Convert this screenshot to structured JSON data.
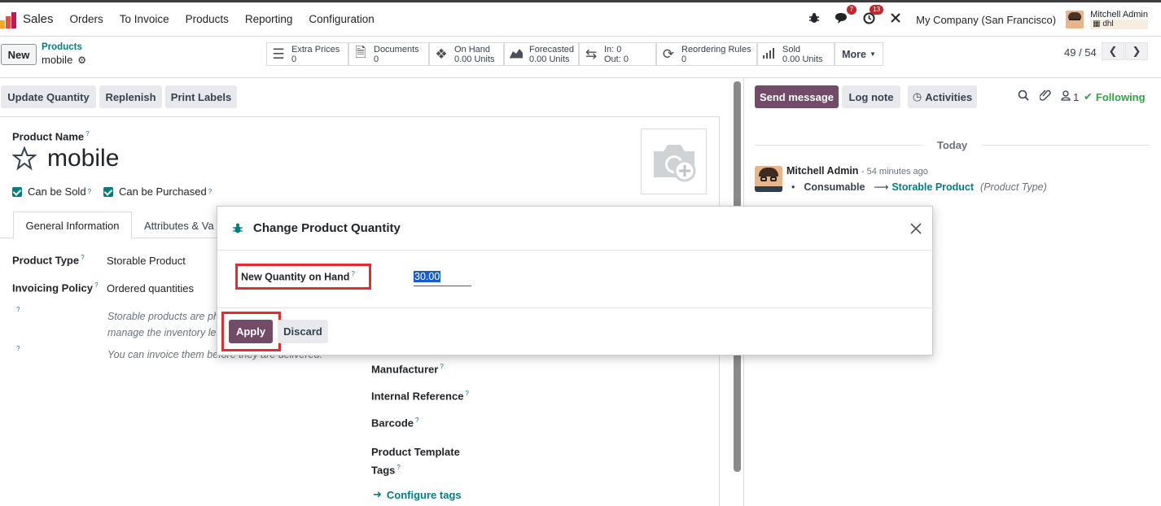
{
  "navbar": {
    "app": "Sales",
    "menu": [
      "Orders",
      "To Invoice",
      "Products",
      "Reporting",
      "Configuration"
    ],
    "messages_badge": "7",
    "activities_badge": "13",
    "company": "My Company (San Francisco)",
    "user_name": "Mitchell Admin",
    "user_db": "dhl"
  },
  "control_panel": {
    "new_label": "New",
    "breadcrumb_parent": "Products",
    "breadcrumb_current": "mobile",
    "smart_buttons": [
      {
        "icon": "list-icon",
        "line1": "Extra Prices",
        "line2": "0"
      },
      {
        "icon": "document-icon",
        "line1": "Documents",
        "line2": "0"
      },
      {
        "icon": "cubes-icon",
        "line1": "On Hand",
        "line2": "0.00 Units"
      },
      {
        "icon": "area-chart-icon",
        "line1": "Forecasted",
        "line2": "0.00 Units"
      },
      {
        "icon": "exchange-icon",
        "line1": "In: 0",
        "line2": "Out: 0"
      },
      {
        "icon": "refresh-icon",
        "line1": "Reordering Rules",
        "line2": "0"
      },
      {
        "icon": "signal-icon",
        "line1": "Sold",
        "line2": "0.00 Units"
      }
    ],
    "more_label": "More",
    "pager": "49 / 54"
  },
  "form": {
    "actions": [
      "Update Quantity",
      "Replenish",
      "Print Labels"
    ],
    "product_name_label": "Product Name",
    "product_name": "mobile",
    "can_be_sold": "Can be Sold",
    "can_be_purchased": "Can be Purchased",
    "tabs": [
      "General Information",
      "Attributes & Va"
    ],
    "product_type_label": "Product Type",
    "product_type": "Storable Product",
    "invoicing_policy_label": "Invoicing Policy",
    "invoicing_policy": "Ordered quantities",
    "help1_line1": "Storable products are ph",
    "help1_line2": "manage the inventory le",
    "help2": "You can invoice them before they are delivered.",
    "manufacturer_label": "Manufacturer",
    "internal_ref_label": "Internal Reference",
    "barcode_label": "Barcode",
    "template_tags_label1": "Product Template",
    "template_tags_label2": "Tags",
    "configure_tags": "Configure tags"
  },
  "chatter": {
    "send_message": "Send message",
    "log_note": "Log note",
    "activities": "Activities",
    "followers_count": "1",
    "following": "Following",
    "date_separator": "Today",
    "author": "Mitchell Admin",
    "time": "- 54 minutes ago",
    "old_value": "Consumable",
    "new_value": "Storable Product",
    "field": "(Product Type)"
  },
  "dialog": {
    "title": "Change Product Quantity",
    "field_label": "New Quantity on Hand",
    "field_value": "30.00",
    "apply": "Apply",
    "discard": "Discard"
  },
  "colors": {
    "primary": "#714b67",
    "teal": "#017e84",
    "highlight": "#e52b2b"
  }
}
